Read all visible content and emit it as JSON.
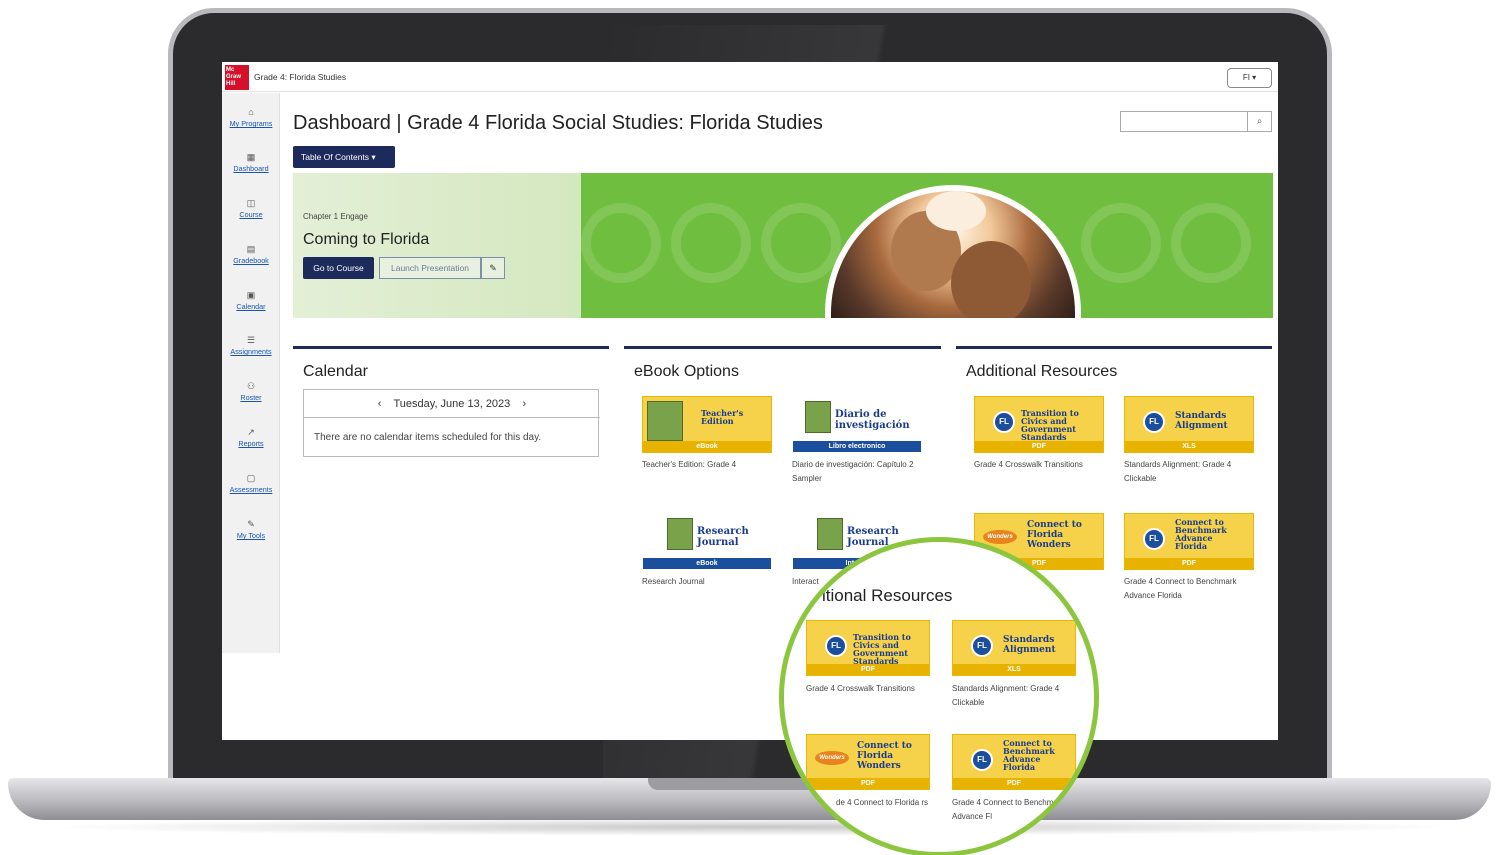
{
  "topbar": {
    "logo_line1": "Mc",
    "logo_line2": "Graw",
    "logo_line3": "Hill",
    "app_title": "Grade 4: Florida Studies",
    "user_button": "FI ▾"
  },
  "sidebar": {
    "items": [
      {
        "label": "My Programs",
        "icon": "home-icon"
      },
      {
        "label": "Dashboard",
        "icon": "dashboard-icon"
      },
      {
        "label": "Course",
        "icon": "book-icon"
      },
      {
        "label": "Gradebook",
        "icon": "gradebook-icon"
      },
      {
        "label": "Calendar",
        "icon": "calendar-icon"
      },
      {
        "label": "Assignments",
        "icon": "assignments-icon"
      },
      {
        "label": "Roster",
        "icon": "roster-icon"
      },
      {
        "label": "Reports",
        "icon": "reports-icon"
      },
      {
        "label": "Assessments",
        "icon": "assessments-icon"
      },
      {
        "label": "My Tools",
        "icon": "tools-icon"
      }
    ]
  },
  "page": {
    "title": "Dashboard | Grade 4 Florida Social Studies: Florida Studies",
    "toc_button": "Table Of Contents ▾",
    "search_placeholder": ""
  },
  "hero": {
    "subtitle": "Chapter 1 Engage",
    "title": "Coming to Florida",
    "go_button": "Go to Course",
    "launch_button": "Launch Presentation",
    "edit_icon": "✎"
  },
  "calendar": {
    "title": "Calendar",
    "prev": "‹",
    "next": "›",
    "date": "Tuesday, June 13, 2023",
    "message": "There are no calendar items scheduled for this day."
  },
  "ebook": {
    "title": "eBook Options",
    "cards": [
      {
        "thumb_title": "Teacher's Edition",
        "thumb_label": "eBook",
        "caption": "Teacher's Edition: Grade 4"
      },
      {
        "thumb_title": "Diario de investigación",
        "thumb_label": "Libro electronico",
        "caption": "Diario de investigación: Capítulo 2 Sampler"
      },
      {
        "thumb_title": "Research Journal",
        "thumb_label": "eBook",
        "caption": "Research Journal"
      },
      {
        "thumb_title": "Research Journal",
        "thumb_label": "Interac",
        "caption": "Interact"
      }
    ]
  },
  "resources": {
    "title": "Additional Resources",
    "cards": [
      {
        "thumb_title": "Transition to Civics and Government Standards",
        "thumb_label": "PDF",
        "caption": "Grade 4 Crosswalk Transitions"
      },
      {
        "thumb_title": "Standards Alignment",
        "thumb_label": "XLS",
        "caption": "Standards Alignment: Grade 4 Clickable"
      },
      {
        "thumb_title": "Connect to Florida Wonders",
        "thumb_label": "PDF",
        "caption": "to Florida"
      },
      {
        "thumb_title": "Connect to Benchmark Advance Florida",
        "thumb_label": "PDF",
        "caption": "Grade 4 Connect to Benchmark Advance Florida"
      }
    ]
  },
  "magnifier": {
    "title": "itional Resources",
    "cards": [
      {
        "thumb_title": "Transition to Civics and Government Standards",
        "thumb_label": "PDF",
        "caption": "Grade 4 Crosswalk Transitions"
      },
      {
        "thumb_title": "Standards Alignment",
        "thumb_label": "XLS",
        "caption": "Standards Alignment: Grade 4 Clickable"
      },
      {
        "thumb_title": "Connect to Florida Wonders",
        "thumb_label": "PDF",
        "caption": "de 4 Connect to Florida rs"
      },
      {
        "thumb_title": "Connect to Benchmark Advance Florida",
        "thumb_label": "PDF",
        "caption": "Grade 4 Connect to Benchmark Advance Fl"
      }
    ]
  },
  "colors": {
    "navy": "#1d2a5c",
    "green": "#6fbe3f",
    "ring": "#8cc63f",
    "yellow": "#f6d24a",
    "label_blue": "#1b4e9c",
    "label_gold": "#e8b200"
  }
}
